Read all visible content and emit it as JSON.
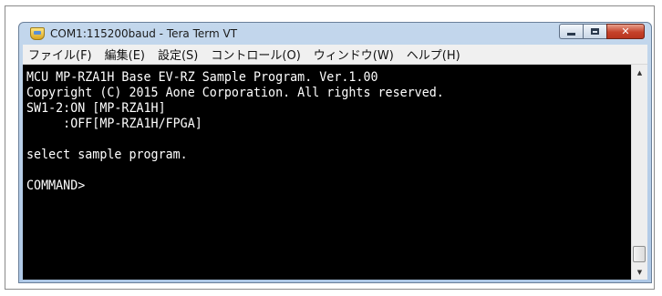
{
  "window": {
    "title": "COM1:115200baud - Tera Term VT",
    "controls": {
      "minimize_icon": "minimize-icon",
      "maximize_icon": "maximize-icon",
      "close_glyph": "✕"
    }
  },
  "menubar": {
    "items": [
      {
        "label": "ファイル(F)"
      },
      {
        "label": "編集(E)"
      },
      {
        "label": "設定(S)"
      },
      {
        "label": "コントロール(O)"
      },
      {
        "label": "ウィンドウ(W)"
      },
      {
        "label": "ヘルプ(H)"
      }
    ]
  },
  "terminal": {
    "lines": [
      "MCU MP-RZA1H Base EV-RZ Sample Program. Ver.1.00",
      "Copyright (C) 2015 Aone Corporation. All rights reserved.",
      "SW1-2:ON [MP-RZA1H]",
      "     :OFF[MP-RZA1H/FPGA]",
      "",
      "select sample program.",
      "",
      "COMMAND>"
    ]
  },
  "scrollbar": {
    "up_glyph": "▲",
    "down_glyph": "▼"
  },
  "colors": {
    "terminal_bg": "#000000",
    "terminal_fg": "#ffffff",
    "close_button": "#c5422b",
    "window_frame": "#aec8e6"
  }
}
